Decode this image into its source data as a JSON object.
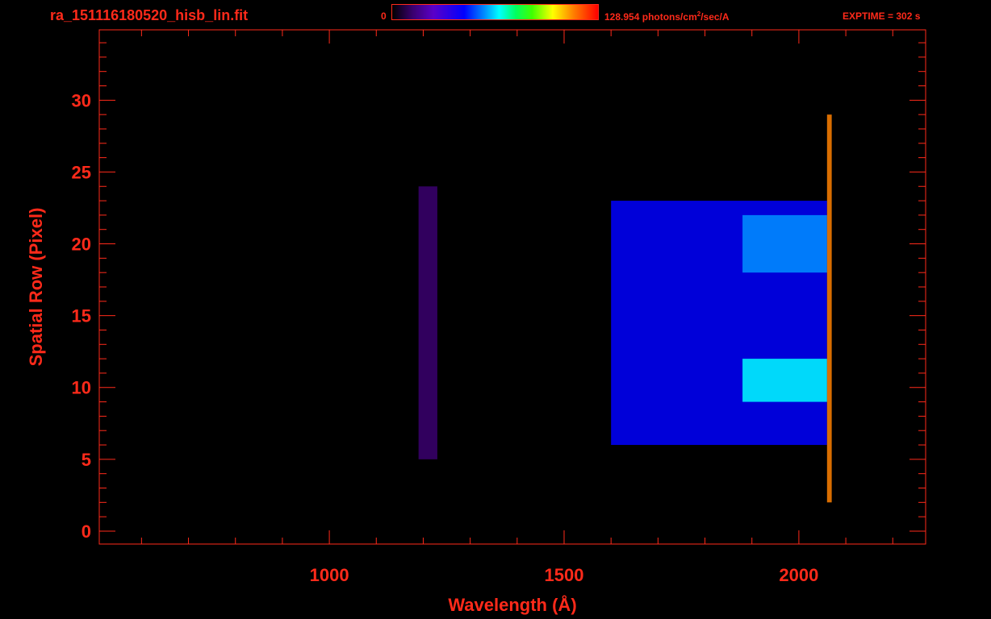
{
  "header": {
    "file_title": "ra_151116180520_hisb_lin.fit",
    "colorbar_min": "0",
    "colorbar_max_value": "128.954",
    "colorbar_units_pre": "photons/cm",
    "colorbar_units_sup": "2",
    "colorbar_units_post": "/sec/A",
    "exptime": "EXPTIME = 302 s"
  },
  "colors": {
    "axis": "#ff2a1a",
    "background": "#000000",
    "colormap": [
      "#000000",
      "#3a006e",
      "#5a00c8",
      "#0000ff",
      "#0090ff",
      "#00ffff",
      "#00ff60",
      "#ffff00",
      "#ff8000",
      "#ff0000"
    ]
  },
  "chart_data": {
    "type": "heatmap",
    "xlabel": "Wavelength (Å)",
    "ylabel": "Spatial Row (Pixel)",
    "xlim": [
      510,
      2270
    ],
    "ylim": [
      -0.9,
      34.9
    ],
    "x_ticks": [
      1000,
      1500,
      2000
    ],
    "x_tick_labels": [
      "1000",
      "1500",
      "2000"
    ],
    "y_ticks": [
      0,
      5,
      10,
      15,
      20,
      25,
      30
    ],
    "y_tick_labels": [
      "0",
      "5",
      "10",
      "15",
      "20",
      "25",
      "30"
    ],
    "value_range": [
      0,
      128.954
    ],
    "value_units": "photons/cm^2/sec/A",
    "rows": 30,
    "features": [
      {
        "x_range": [
          1190,
          1230
        ],
        "y_range": [
          5,
          24
        ],
        "level": 0.14
      },
      {
        "x_range": [
          1600,
          2060
        ],
        "y_range": [
          6,
          23
        ],
        "level": 0.3
      },
      {
        "x_range": [
          1880,
          2060
        ],
        "y_range": [
          9,
          12
        ],
        "level": 0.5
      },
      {
        "x_range": [
          1880,
          2060
        ],
        "y_range": [
          18,
          22
        ],
        "level": 0.45
      },
      {
        "x_range": [
          2060,
          2070
        ],
        "y_range": [
          2,
          29
        ],
        "level": 0.9
      }
    ]
  }
}
